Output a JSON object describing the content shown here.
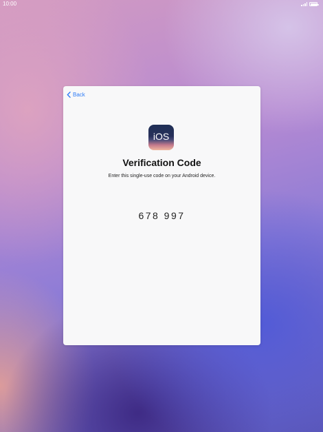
{
  "status_bar": {
    "time": "10:00"
  },
  "card": {
    "back_label": "Back",
    "app_icon_label": "iOS",
    "title": "Verification Code",
    "subtitle": "Enter this single-use code on your Android device.",
    "code": "678 997"
  },
  "colors": {
    "accent": "#2f7cf6",
    "card_background": "#f8f8f9"
  },
  "icons": [
    "chevron-left-icon",
    "signal-icon",
    "battery-icon"
  ]
}
